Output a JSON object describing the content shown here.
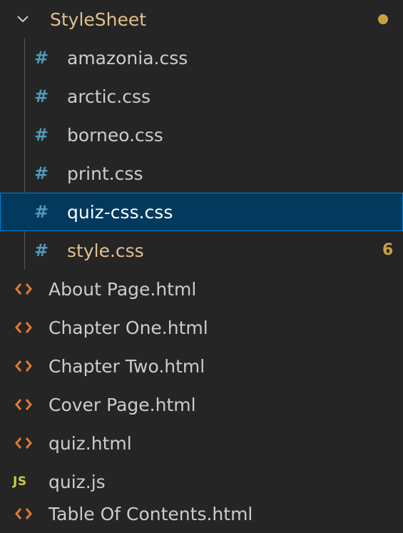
{
  "folder": {
    "name": "StyleSheet",
    "icon": "chevron-down-icon",
    "has_modified_dot": true,
    "files": [
      {
        "name": "amazonia.css",
        "icon": "css-hash-icon",
        "icon_glyph": "#"
      },
      {
        "name": "arctic.css",
        "icon": "css-hash-icon",
        "icon_glyph": "#"
      },
      {
        "name": "borneo.css",
        "icon": "css-hash-icon",
        "icon_glyph": "#"
      },
      {
        "name": "print.css",
        "icon": "css-hash-icon",
        "icon_glyph": "#"
      },
      {
        "name": "quiz-css.css",
        "icon": "css-hash-icon",
        "icon_glyph": "#",
        "selected": true
      },
      {
        "name": "style.css",
        "icon": "css-hash-icon",
        "icon_glyph": "#",
        "modified": true,
        "badge": "6"
      }
    ]
  },
  "root_files": [
    {
      "name": "About Page.html",
      "icon": "html-brackets-icon"
    },
    {
      "name": "Chapter One.html",
      "icon": "html-brackets-icon"
    },
    {
      "name": "Chapter Two.html",
      "icon": "html-brackets-icon"
    },
    {
      "name": "Cover Page.html",
      "icon": "html-brackets-icon"
    },
    {
      "name": "quiz.html",
      "icon": "html-brackets-icon"
    },
    {
      "name": "quiz.js",
      "icon": "js-icon",
      "icon_glyph": "JS"
    },
    {
      "name": "Table Of Contents.html",
      "icon": "html-brackets-icon"
    }
  ],
  "colors": {
    "background": "#252526",
    "selected_background": "#04395e",
    "selected_border": "#007fd4",
    "folder_text": "#e2c08d",
    "modified_text": "#e2c08d",
    "css_icon": "#519aba",
    "html_icon": "#e37933",
    "js_icon": "#cbcb41",
    "badge": "#c9a23f",
    "text": "#cccccc"
  }
}
